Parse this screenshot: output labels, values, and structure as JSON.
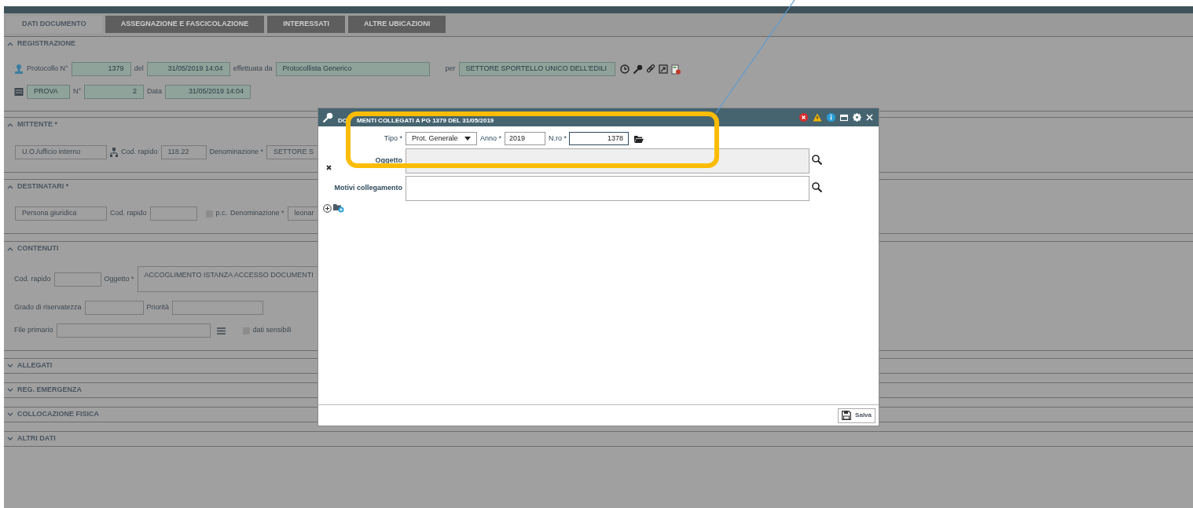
{
  "tabs": [
    {
      "label": "DATI DOCUMENTO",
      "selected": true
    },
    {
      "label": "ASSEGNAZIONE E FASCICOLAZIONE",
      "selected": false
    },
    {
      "label": "INTERESSATI",
      "selected": false
    },
    {
      "label": "ALTRE UBICAZIONI",
      "selected": false
    }
  ],
  "registrazione": {
    "title": "REGISTRAZIONE",
    "expanded": true,
    "protocollo_label": "Protocollo N°",
    "protocollo": "1379",
    "del_label": "del",
    "del": "31/05/2019 14:04",
    "effettuata_label": "effettuata da",
    "effettuata_da": "Protocollista Generico",
    "per_label": "per",
    "per": "SETTORE SPORTELLO UNICO DELL'EDILI",
    "registro": "PROVA",
    "n_label": "N°",
    "n": "2",
    "data_label": "Data",
    "data": "31/05/2019 14:04"
  },
  "mittente": {
    "title": "MITTENTE *",
    "expanded": true,
    "tipo": "U.O./ufficio interno",
    "cod_label": "Cod. rapido",
    "cod": "118.22",
    "den_label": "Denominazione *",
    "den": "SETTORE S"
  },
  "destinatari": {
    "title": "DESTINATARI *",
    "expanded": true,
    "tipo": "Persona giuridica",
    "cod_label": "Cod. rapido",
    "pc_label": "p.c.",
    "pc_checked": false,
    "den_label": "Denominazione *",
    "den": "leonar"
  },
  "contenuti": {
    "title": "CONTENUTI",
    "expanded": true,
    "cod_label": "Cod. rapido",
    "oggetto_label": "Oggetto *",
    "oggetto": "ACCOGLIMENTO ISTANZA ACCESSO DOCUMENTI",
    "grado_label": "Grado di riservatezza",
    "priorita_label": "Priorità",
    "file_label": "File primario",
    "sensibili_label": "dati sensibili",
    "sensibili_checked": false
  },
  "collapsed_sections": [
    {
      "title": "ALLEGATI",
      "expanded": false
    },
    {
      "title": "REG. EMERGENZA",
      "expanded": false
    },
    {
      "title": "COLLOCAZIONE FISICA",
      "expanded": false
    },
    {
      "title": "ALTRI DATI",
      "expanded": false
    }
  ],
  "dialog": {
    "title_parts": [
      "DO",
      "MENTI COLLEGATI A PG 1379 DEL 31/05/2019"
    ],
    "tipo_label": "Tipo *",
    "tipo": "Prot. Generale",
    "anno_label": "Anno *",
    "anno": "2019",
    "nro_label": "N.ro *",
    "nro": "1378",
    "oggetto_label": "Oggetto",
    "motivi_label": "Motivi collegamento",
    "save": "Salva"
  }
}
